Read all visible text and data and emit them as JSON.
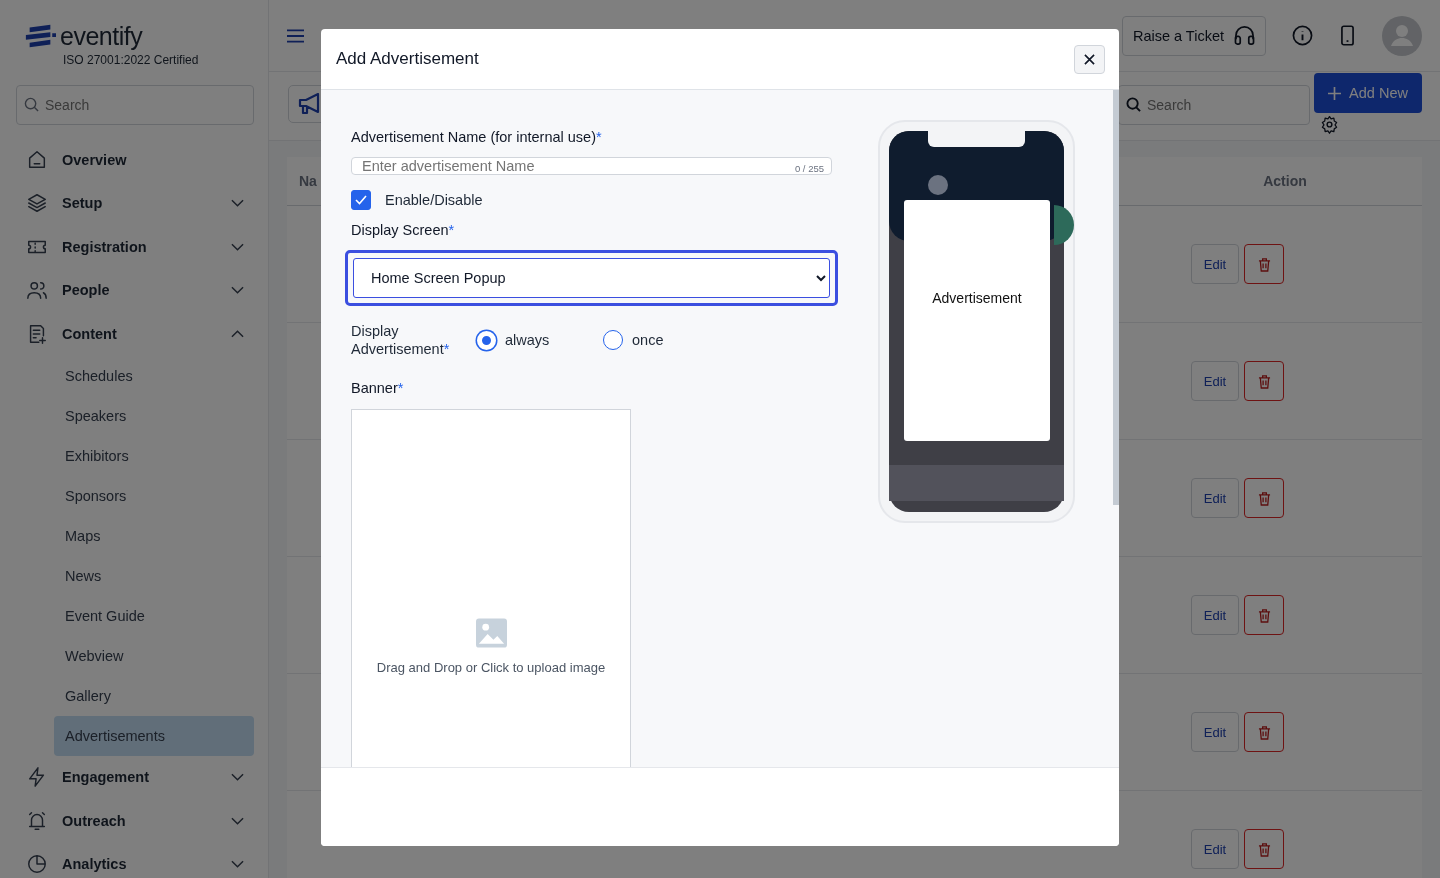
{
  "brand": {
    "name": "eventify",
    "tagline": "ISO 27001:2022 Certified"
  },
  "sidebar": {
    "search": {
      "placeholder": "Search"
    },
    "items": [
      {
        "label": "Overview"
      },
      {
        "label": "Setup",
        "expanded": false
      },
      {
        "label": "Registration",
        "expanded": false
      },
      {
        "label": "People",
        "expanded": false
      },
      {
        "label": "Content",
        "expanded": true,
        "children": [
          {
            "label": "Schedules",
            "selected": false
          },
          {
            "label": "Speakers",
            "selected": false
          },
          {
            "label": "Exhibitors",
            "selected": false
          },
          {
            "label": "Sponsors",
            "selected": false
          },
          {
            "label": "Maps",
            "selected": false
          },
          {
            "label": "News",
            "selected": false
          },
          {
            "label": "Event Guide",
            "selected": false
          },
          {
            "label": "Webview",
            "selected": false
          },
          {
            "label": "Gallery",
            "selected": false
          },
          {
            "label": "Advertisements",
            "selected": true
          }
        ]
      },
      {
        "label": "Engagement",
        "expanded": false
      },
      {
        "label": "Outreach",
        "expanded": false
      },
      {
        "label": "Analytics",
        "expanded": false
      }
    ]
  },
  "header": {
    "ticket_button": "Raise a Ticket"
  },
  "toolbar": {
    "search": {
      "placeholder": "Search"
    },
    "add_button": "Add New"
  },
  "table": {
    "columns": [
      "Na",
      "Action"
    ],
    "rows": [
      {
        "edit": "Edit"
      },
      {
        "edit": "Edit"
      },
      {
        "edit": "Edit"
      },
      {
        "edit": "Edit"
      },
      {
        "edit": "Edit"
      },
      {
        "edit": "Edit"
      }
    ]
  },
  "modal": {
    "title": "Add Advertisement",
    "name_field": {
      "label": "Advertisement Name (for internal use)",
      "required_mark": "*",
      "placeholder": "Enter advertisement Name",
      "counter": "0 / 255"
    },
    "enable": {
      "label": "Enable/Disable",
      "checked": true
    },
    "display_screen": {
      "label": "Display Screen",
      "required_mark": "*",
      "value": "Home Screen Popup",
      "focused": true
    },
    "display_mode": {
      "label": "Display Advertisement",
      "required_mark": "*",
      "options": [
        {
          "label": "always",
          "selected": true
        },
        {
          "label": "once",
          "selected": false
        }
      ]
    },
    "banner": {
      "label": "Banner",
      "required_mark": "*",
      "hint": "Drag and Drop or Click to upload image"
    },
    "preview": {
      "ad_label": "Advertisement"
    }
  }
}
